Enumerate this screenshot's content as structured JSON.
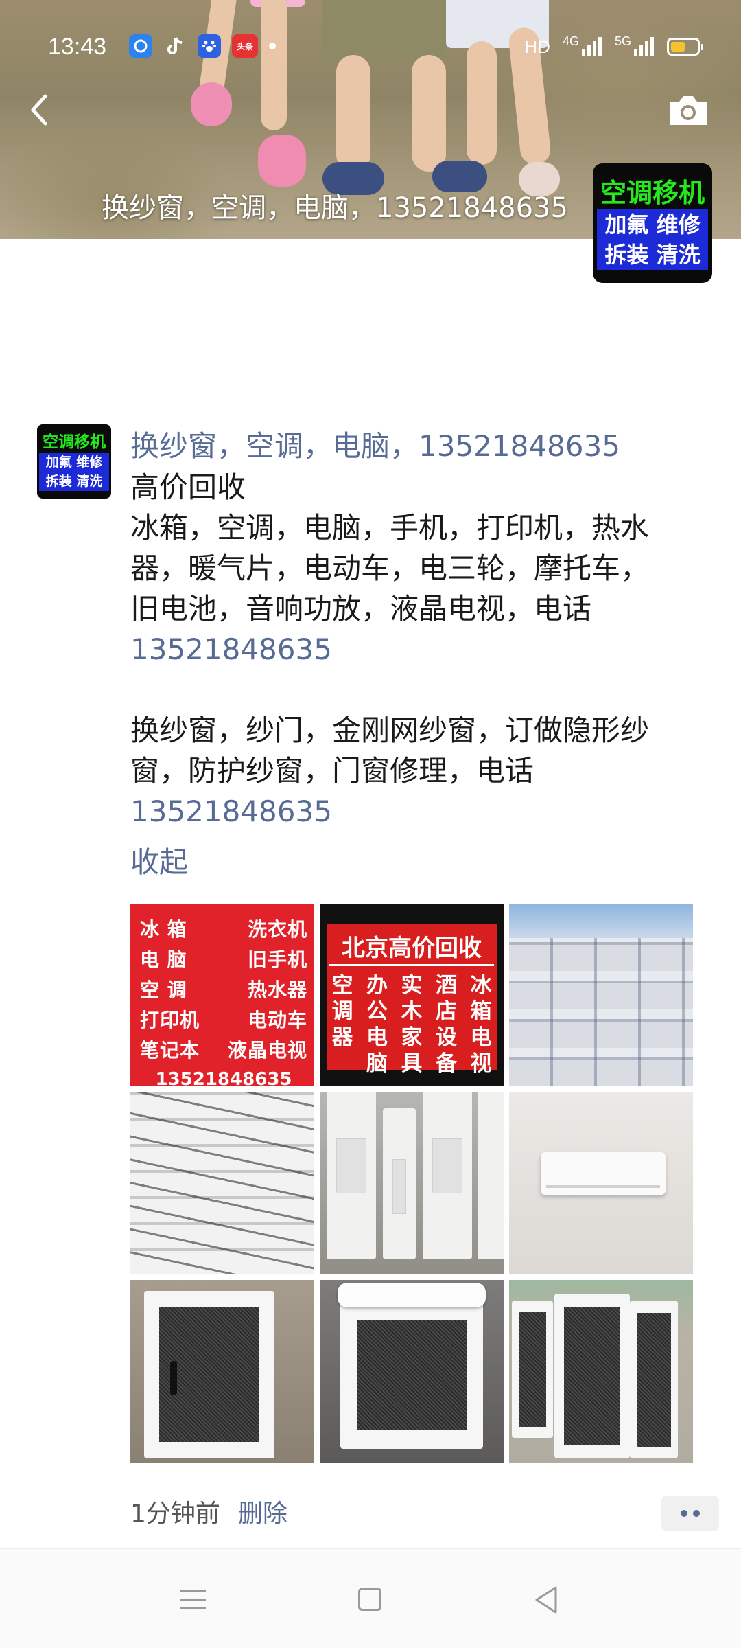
{
  "status_bar": {
    "time": "13:43",
    "app_icons": [
      "toutiao-icon",
      "tiktok-icon",
      "baidu-icon",
      "news-icon"
    ],
    "app_icon_labels": {
      "news": "头条"
    },
    "network_left": "HD",
    "network_1": "4G",
    "network_2": "5G"
  },
  "cover": {
    "caption": "换纱窗，空调，电脑，13521848635"
  },
  "avatar": {
    "line1": "空调移机",
    "line2": "加氟 维修",
    "line3": "拆装 清洗"
  },
  "post": {
    "name": "换纱窗，空调，电脑，13521848635",
    "lines": [
      {
        "text": "高价回收"
      },
      {
        "text": "冰箱，空调，电脑，手机，打印机，热水"
      },
      {
        "text": "器，暖气片，电动车，电三轮，摩托车，"
      },
      {
        "text": "旧电池，音响功放，液晶电视，电话"
      },
      {
        "phone": "13521848635"
      },
      {
        "text": ""
      },
      {
        "text": "换纱窗，纱门，金刚网纱窗，订做隐形纱"
      },
      {
        "text": "窗，防护纱窗，门窗修理，电话"
      },
      {
        "phone": "13521848635"
      }
    ],
    "collapse_label": "收起"
  },
  "photos": {
    "sign1": {
      "rows": [
        [
          "冰  箱",
          "洗衣机"
        ],
        [
          "电  脑",
          "旧手机"
        ],
        [
          "空  调",
          "热水器"
        ],
        [
          "打印机",
          "电动车"
        ],
        [
          "笔记本",
          "液晶电视"
        ]
      ],
      "phone": "13521848635"
    },
    "sign2": {
      "headline": "北京高价回收",
      "columns": [
        "空调器",
        "办公电脑",
        "实木家具",
        "酒店设备",
        "冰箱电视"
      ]
    }
  },
  "footer": {
    "time_ago": "1分钟前",
    "delete_label": "删除"
  },
  "colors": {
    "link": "#576b95",
    "text": "#1a1a1a",
    "avatar_green": "#26e81d",
    "avatar_blue": "#1d2ad8",
    "sign_red": "#e2222a"
  }
}
